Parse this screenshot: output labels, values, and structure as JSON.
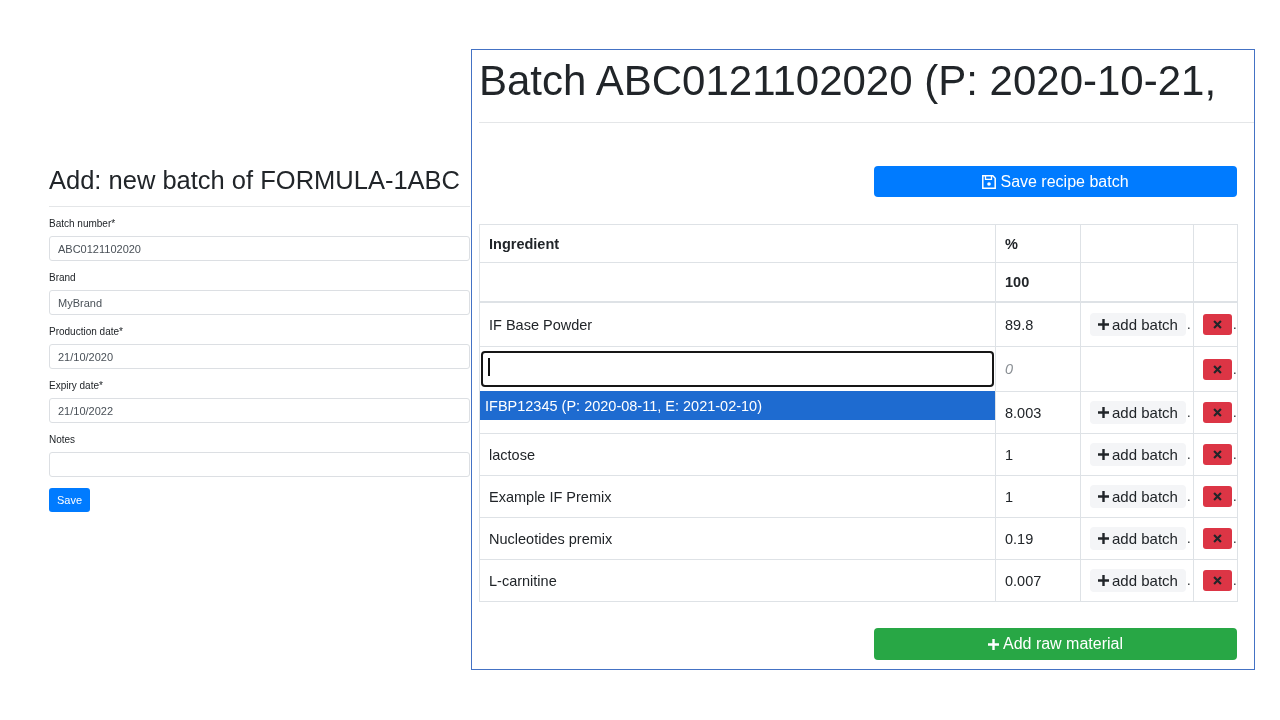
{
  "batch_form": {
    "title": "Add: new batch of FORMULA-1ABC",
    "fields": [
      {
        "label": "Batch number*",
        "value": "ABC0121102020"
      },
      {
        "label": "Brand",
        "value": "MyBrand"
      },
      {
        "label": "Production date*",
        "value": "21/10/2020"
      },
      {
        "label": "Expiry date*",
        "value": "21/10/2022"
      },
      {
        "label": "Notes"
      }
    ],
    "save_button": "Save"
  },
  "recipe_window": {
    "title": "Batch ABC0121102020 (P: 2020-10-21,",
    "save_button": "Save recipe batch",
    "table": {
      "columns": [
        "Ingredient",
        "%"
      ],
      "total": "100",
      "rows": [
        {
          "kind": "ingredient",
          "ingredient": "IF Base Powder",
          "percent": "89.8",
          "add_batch": "add batch",
          "add_batch_tail": ".",
          "remove_tail": "."
        },
        {
          "kind": "editing",
          "focused": true,
          "percent_placeholder": "0",
          "suggestions": [
            {
              "label": "IFBP12345 (P: 2020-08-11, E: 2021-02-10)",
              "selected": true
            }
          ],
          "remove_tail": "."
        },
        {
          "kind": "ingredient",
          "percent": "8.003",
          "add_batch": "add batch",
          "add_batch_tail": ".",
          "remove_tail": "."
        },
        {
          "kind": "ingredient",
          "ingredient": "lactose",
          "percent": "1",
          "add_batch": "add batch",
          "add_batch_tail": ".",
          "remove_tail": "."
        },
        {
          "kind": "ingredient",
          "ingredient": "Example IF Premix",
          "percent": "1",
          "add_batch": "add batch",
          "add_batch_tail": ".",
          "remove_tail": "."
        },
        {
          "kind": "ingredient",
          "ingredient": "Nucleotides premix",
          "percent": "0.19",
          "add_batch": "add batch",
          "add_batch_tail": ".",
          "remove_tail": "."
        },
        {
          "kind": "ingredient",
          "ingredient": "L-carnitine",
          "percent": "0.007",
          "add_batch": "add batch",
          "add_batch_tail": ".",
          "remove_tail": "."
        }
      ]
    },
    "add_button": "Add raw material"
  }
}
